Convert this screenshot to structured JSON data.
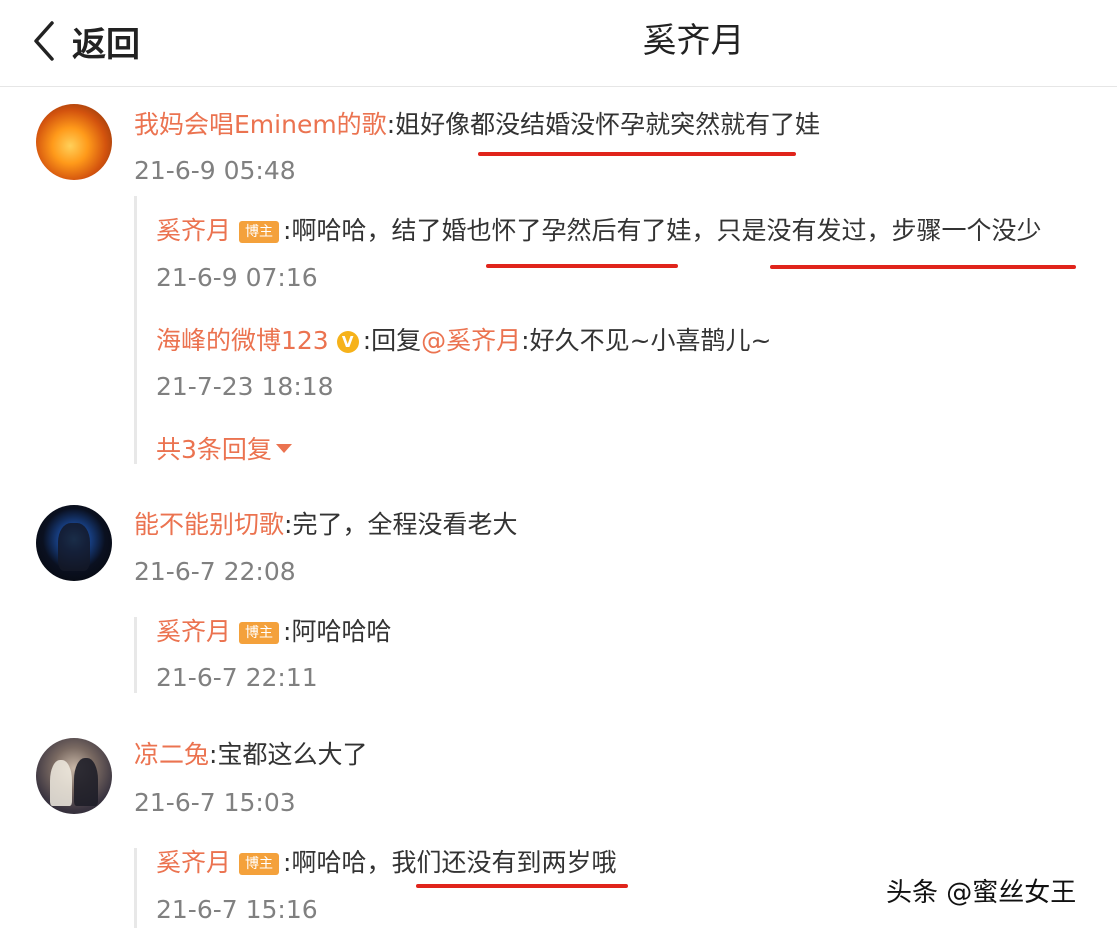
{
  "header": {
    "back_label": "返回",
    "title": "奚齐月"
  },
  "comments": [
    {
      "user": "我妈会唱Eminem的歌",
      "text": ":姐好像都没结婚没怀孕就突然就有了娃",
      "time": "21-6-9 05:48",
      "replies": [
        {
          "user": "奚齐月",
          "badge": "博主",
          "text": ":啊哈哈，结了婚也怀了孕然后有了娃，只是没有发过，步骤一个没少",
          "time": "21-6-9 07:16"
        },
        {
          "user": "海峰的微博123",
          "verified": "V",
          "prefix": ":回复",
          "mention": "@奚齐月",
          "text": ":好久不见~小喜鹊儿~",
          "time": "21-7-23 18:18"
        }
      ],
      "more_replies": "共3条回复"
    },
    {
      "user": "能不能别切歌",
      "text": ":完了，全程没看老大",
      "time": "21-6-7 22:08",
      "replies": [
        {
          "user": "奚齐月",
          "badge": "博主",
          "text": ":阿哈哈哈",
          "time": "21-6-7 22:11"
        }
      ]
    },
    {
      "user": "凉二兔",
      "text": ":宝都这么大了",
      "time": "21-6-7 15:03",
      "replies": [
        {
          "user": "奚齐月",
          "badge": "博主",
          "text": ":啊哈哈，我们还没有到两岁哦",
          "time": "21-6-7 15:16"
        }
      ]
    }
  ],
  "watermark": "头条 @蜜丝女王",
  "colors": {
    "username": "#eb7350",
    "timestamp": "#808080",
    "badge": "#f4a13b",
    "annotation_underline": "#e0241b"
  }
}
